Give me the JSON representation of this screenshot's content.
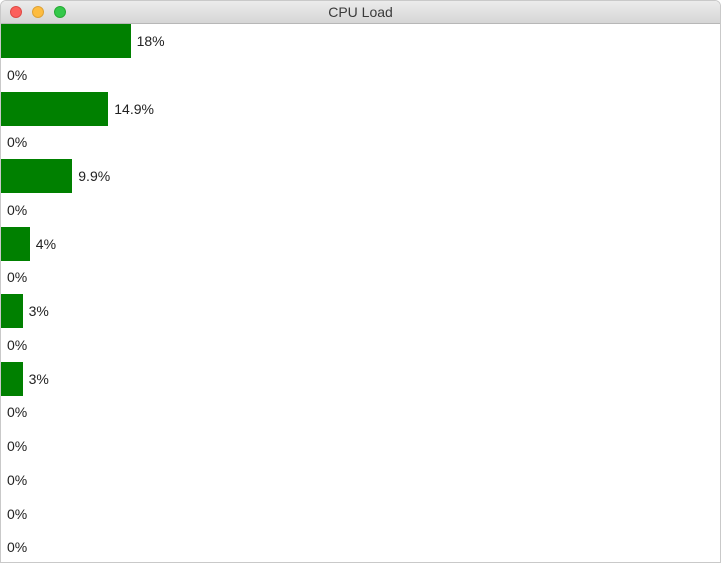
{
  "window": {
    "title": "CPU Load"
  },
  "bar_color": "#008000",
  "cores": [
    {
      "value": 18,
      "label": "18%"
    },
    {
      "value": 0,
      "label": "0%"
    },
    {
      "value": 14.9,
      "label": "14.9%"
    },
    {
      "value": 0,
      "label": "0%"
    },
    {
      "value": 9.9,
      "label": "9.9%"
    },
    {
      "value": 0,
      "label": "0%"
    },
    {
      "value": 4,
      "label": "4%"
    },
    {
      "value": 0,
      "label": "0%"
    },
    {
      "value": 3,
      "label": "3%"
    },
    {
      "value": 0,
      "label": "0%"
    },
    {
      "value": 3,
      "label": "3%"
    },
    {
      "value": 0,
      "label": "0%"
    },
    {
      "value": 0,
      "label": "0%"
    },
    {
      "value": 0,
      "label": "0%"
    },
    {
      "value": 0,
      "label": "0%"
    },
    {
      "value": 0,
      "label": "0%"
    }
  ]
}
